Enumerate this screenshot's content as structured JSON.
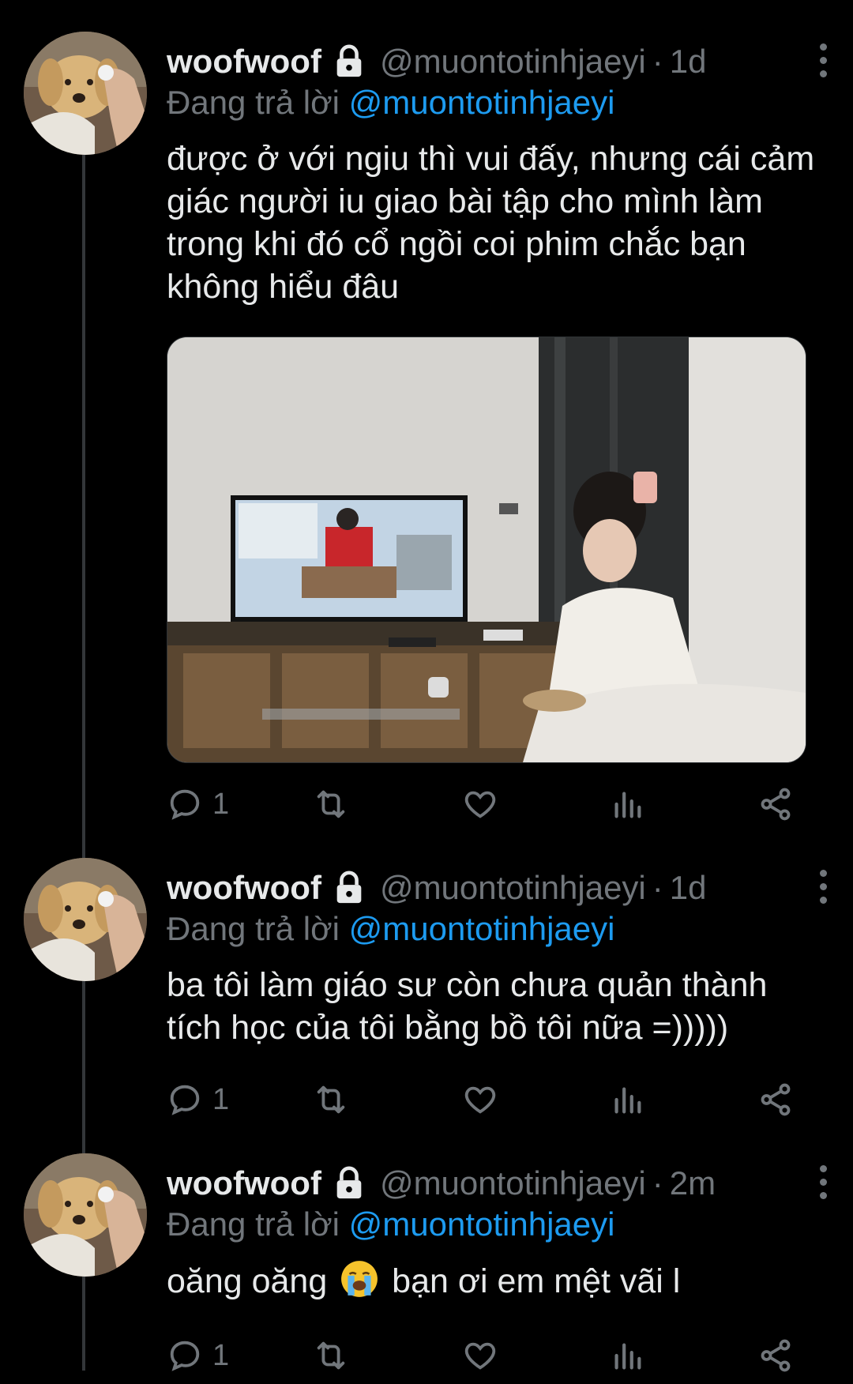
{
  "colors": {
    "background": "#000000",
    "text": "#e7e9ea",
    "muted": "#71767b",
    "accent": "#1d9bf0"
  },
  "tweets": [
    {
      "name": "woofwoof",
      "handle": "@muontotinhjaeyi",
      "separator": "·",
      "time": "1d",
      "reply_prefix": "Đang trả lời",
      "reply_to": "@muontotinhjaeyi",
      "text": "được ở với ngiu thì vui đấy, nhưng cái cảm giác người iu giao bài tập cho mình làm trong khi đó cổ ngồi coi phim chắc bạn không hiểu đâu",
      "reply_count": "1",
      "icons": [
        "lock-icon",
        "reply-icon",
        "retweet-icon",
        "like-icon",
        "views-icon",
        "share-icon",
        "more-icon"
      ]
    },
    {
      "name": "woofwoof",
      "handle": "@muontotinhjaeyi",
      "separator": "·",
      "time": "1d",
      "reply_prefix": "Đang trả lời",
      "reply_to": "@muontotinhjaeyi",
      "text": "ba tôi làm giáo sư còn chưa quản thành tích học của tôi bằng bồ tôi nữa =)))))",
      "reply_count": "1"
    },
    {
      "name": "woofwoof",
      "handle": "@muontotinhjaeyi",
      "separator": "·",
      "time": "2m",
      "reply_prefix": "Đang trả lời",
      "reply_to": "@muontotinhjaeyi",
      "text_before": "oăng oăng",
      "text_emoji": "😭",
      "text_after": "bạn ơi em mệt vãi l",
      "reply_count": "1"
    }
  ]
}
